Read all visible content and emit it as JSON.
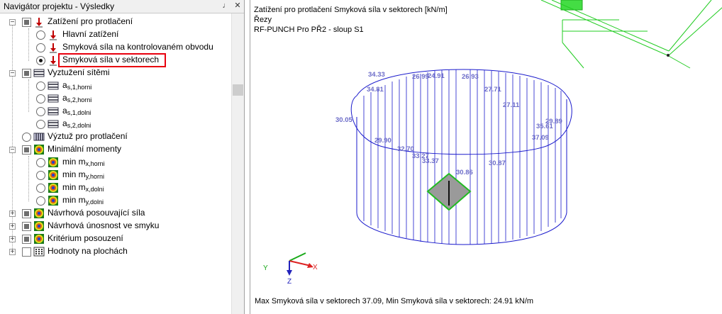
{
  "navigator": {
    "title": "Navigátor projektu - Výsledky",
    "pin_glyph": "♩",
    "close_glyph": "✕",
    "items": [
      {
        "label": "Zatížení pro protlačení"
      },
      {
        "label": "Hlavní zatížení"
      },
      {
        "label": "Smyková síla na kontrolovaném obvodu"
      },
      {
        "label": "Smyková síla v sektorech"
      },
      {
        "label": "Vyztužení sítěmi"
      },
      {
        "base": "a",
        "sub": "s,1,horni"
      },
      {
        "base": "a",
        "sub": "s,2,horni"
      },
      {
        "base": "a",
        "sub": "s,1,dolni"
      },
      {
        "base": "a",
        "sub": "s,2,dolni"
      },
      {
        "label": "Výztuž pro protlačení"
      },
      {
        "label": "Minimální momenty"
      },
      {
        "base": "min m",
        "sub": "x,horni"
      },
      {
        "base": "min m",
        "sub": "y,horni"
      },
      {
        "base": "min m",
        "sub": "x,dolni"
      },
      {
        "base": "min m",
        "sub": "y,dolni"
      },
      {
        "label": "Návrhová posouvající síla"
      },
      {
        "label": "Návrhová únosnost ve smyku"
      },
      {
        "label": "Kritérium posouzení"
      },
      {
        "label": "Hodnoty na plochách"
      }
    ]
  },
  "view": {
    "title_line1": "Zatížení pro protlačení Smyková síla v sektorech [kN/m]",
    "title_line2": "Řezy",
    "title_line3": "RF-PUNCH Pro PŘ2 - sloup S1",
    "status": "Max Smyková síla v sektorech  37.09,  Min Smyková síla v sektorech: 24.91 kN/m",
    "axes": {
      "x": "X",
      "y": "Y",
      "z": "Z"
    },
    "values": [
      "34.33",
      "26.99",
      "24.91",
      "26.93",
      "34.81",
      "27.71",
      "27.11",
      "30.05",
      "29.89",
      "35.61",
      "37.09",
      "29.90",
      "32.70",
      "33.27",
      "33.37",
      "30.86",
      "30.87"
    ]
  },
  "colors": {
    "value_label": "#6b6bc8",
    "diagram_line": "#1a1acc",
    "highlight": "#e8000f",
    "column": "#9a9a9a",
    "column_outline": "#22bb22"
  }
}
